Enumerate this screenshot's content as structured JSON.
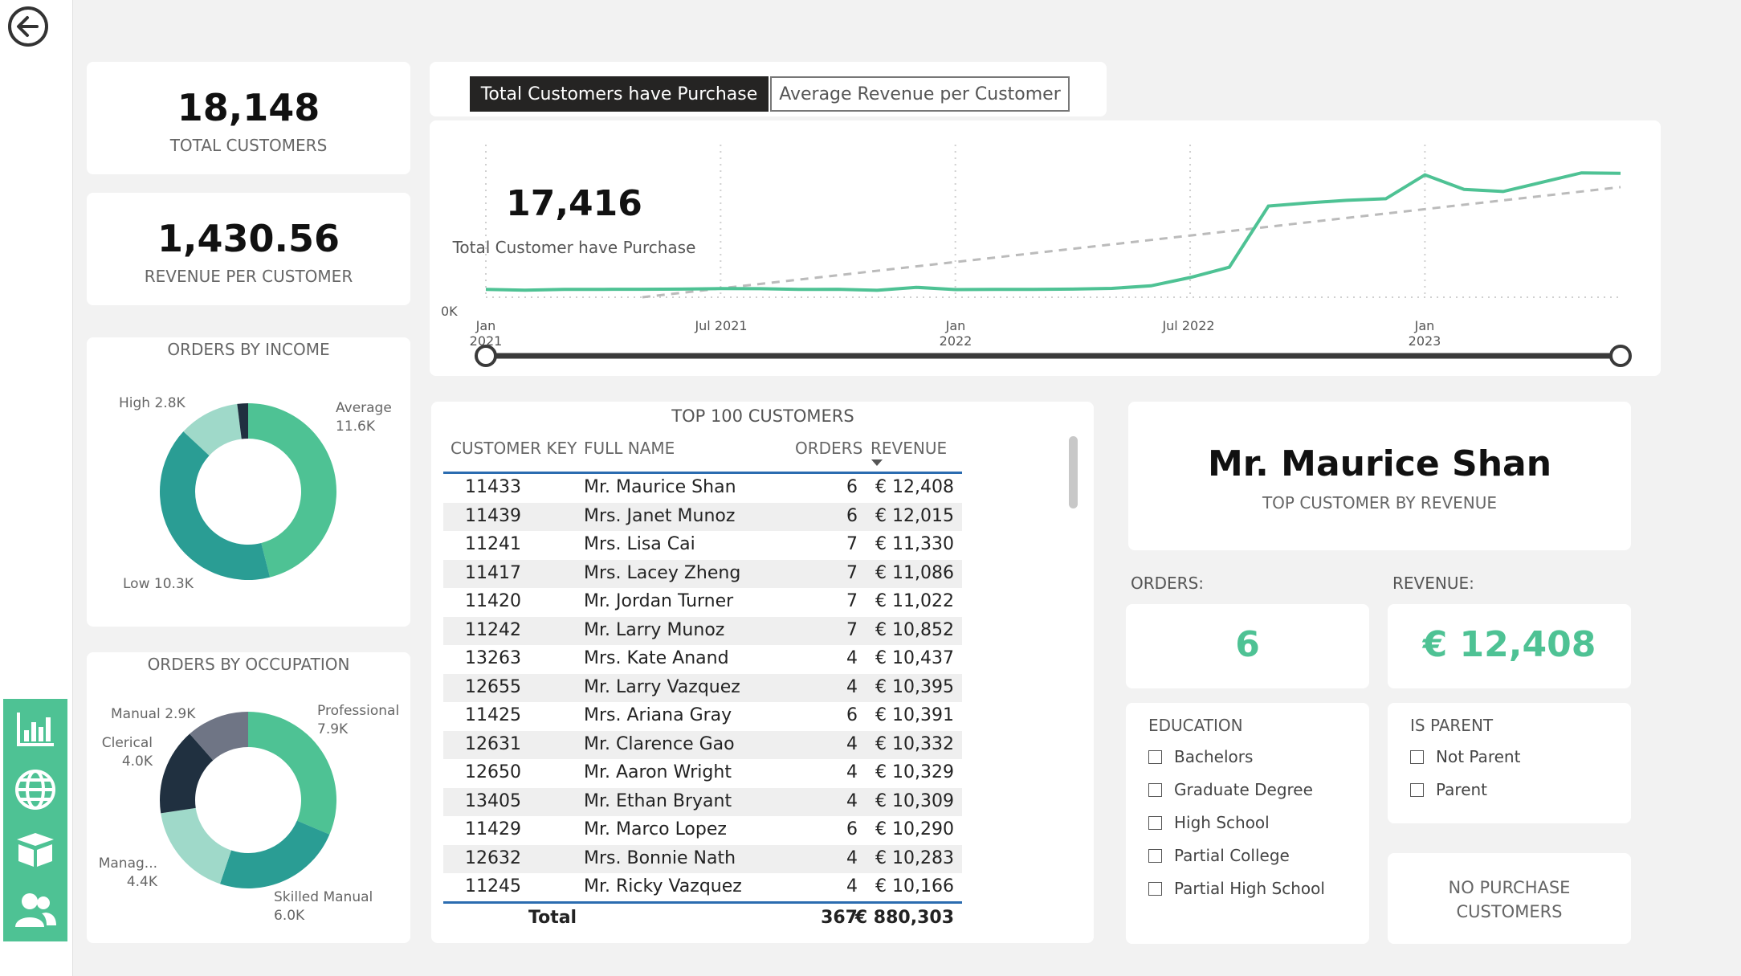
{
  "kpis": {
    "total_customers": {
      "value": "18,148",
      "label": "TOTAL CUSTOMERS"
    },
    "revenue_per_customer": {
      "value": "1,430.56",
      "label": "REVENUE PER CUSTOMER"
    }
  },
  "tabs": [
    {
      "label": "Total Customers have Purchase",
      "active": true
    },
    {
      "label": "Average Revenue per Customer",
      "active": false
    }
  ],
  "line_chart": {
    "kpi_value": "17,416",
    "kpi_label": "Total Customer have Purchase",
    "y_tick": "0K",
    "x_ticks": [
      "Jan 2021",
      "Jul 2021",
      "Jan 2022",
      "Jul 2022",
      "Jan 2023"
    ],
    "line_color": "#4ec294",
    "trend_color": "#bbbbbb"
  },
  "income_chart": {
    "title": "ORDERS BY INCOME",
    "labels": [
      {
        "name": "Average",
        "value": "11.6K"
      },
      {
        "name": "Low",
        "value": "10.3K"
      },
      {
        "name": "High",
        "value": "2.8K"
      }
    ]
  },
  "occupation_chart": {
    "title": "ORDERS BY OCCUPATION",
    "labels": [
      {
        "name": "Professional",
        "value": "7.9K"
      },
      {
        "name": "Skilled Manual",
        "value": "6.0K"
      },
      {
        "name": "Manag...",
        "value": "4.4K"
      },
      {
        "name": "Clerical",
        "value": "4.0K"
      },
      {
        "name": "Manual",
        "value": "2.9K"
      }
    ]
  },
  "chart_data": [
    {
      "type": "line",
      "title": "Total Customer have Purchase",
      "x": [
        "2021-01",
        "2021-02",
        "2021-03",
        "2021-04",
        "2021-05",
        "2021-06",
        "2021-07",
        "2021-08",
        "2021-09",
        "2021-10",
        "2021-11",
        "2021-12",
        "2022-01",
        "2022-02",
        "2022-03",
        "2022-04",
        "2022-05",
        "2022-06",
        "2022-07",
        "2022-08",
        "2022-09",
        "2022-10",
        "2022-11",
        "2022-12",
        "2023-01",
        "2023-02",
        "2023-03",
        "2023-04",
        "2023-05",
        "2023-06"
      ],
      "series": [
        {
          "values": [
            75,
            68,
            75,
            76,
            77,
            78,
            83,
            82,
            75,
            77,
            67,
            95,
            74,
            76,
            76,
            78,
            85,
            110,
            190,
            290,
            880,
            910,
            935,
            950,
            1180,
            1040,
            1020,
            1110,
            1200,
            1195
          ]
        }
      ],
      "y_min": 0,
      "y_max": 1240,
      "trendline": true,
      "xlabel": "",
      "ylabel": ""
    },
    {
      "type": "pie",
      "title": "ORDERS BY INCOME",
      "labels": [
        "Average",
        "Low",
        "High",
        "Other"
      ],
      "values": [
        11.6,
        10.3,
        2.8,
        0.5
      ],
      "colors": [
        "#4ec294",
        "#2a9d94",
        "#9fd9c9",
        "#203040"
      ]
    },
    {
      "type": "pie",
      "title": "ORDERS BY OCCUPATION",
      "labels": [
        "Professional",
        "Skilled Manual",
        "Manag...",
        "Clerical",
        "Manual"
      ],
      "values": [
        7.9,
        6.0,
        4.4,
        4.0,
        2.9
      ],
      "colors": [
        "#4ec294",
        "#2a9d94",
        "#9fd9c9",
        "#203040",
        "#6f7585"
      ]
    }
  ],
  "table": {
    "title": "TOP 100 CUSTOMERS",
    "headers": {
      "key": "CUSTOMER KEY",
      "name": "FULL NAME",
      "orders": "ORDERS",
      "revenue": "REVENUE"
    },
    "rows": [
      {
        "key": "11433",
        "name": "Mr. Maurice Shan",
        "orders": "6",
        "revenue": "€ 12,408"
      },
      {
        "key": "11439",
        "name": "Mrs. Janet Munoz",
        "orders": "6",
        "revenue": "€ 12,015"
      },
      {
        "key": "11241",
        "name": "Mrs. Lisa Cai",
        "orders": "7",
        "revenue": "€ 11,330"
      },
      {
        "key": "11417",
        "name": "Mrs. Lacey Zheng",
        "orders": "7",
        "revenue": "€ 11,086"
      },
      {
        "key": "11420",
        "name": "Mr. Jordan Turner",
        "orders": "7",
        "revenue": "€ 11,022"
      },
      {
        "key": "11242",
        "name": "Mr. Larry Munoz",
        "orders": "7",
        "revenue": "€ 10,852"
      },
      {
        "key": "13263",
        "name": "Mrs. Kate Anand",
        "orders": "4",
        "revenue": "€ 10,437"
      },
      {
        "key": "12655",
        "name": "Mr. Larry Vazquez",
        "orders": "4",
        "revenue": "€ 10,395"
      },
      {
        "key": "11425",
        "name": "Mrs. Ariana Gray",
        "orders": "6",
        "revenue": "€ 10,391"
      },
      {
        "key": "12631",
        "name": "Mr. Clarence Gao",
        "orders": "4",
        "revenue": "€ 10,332"
      },
      {
        "key": "12650",
        "name": "Mr. Aaron Wright",
        "orders": "4",
        "revenue": "€ 10,329"
      },
      {
        "key": "13405",
        "name": "Mr. Ethan Bryant",
        "orders": "4",
        "revenue": "€ 10,309"
      },
      {
        "key": "11429",
        "name": "Mr. Marco Lopez",
        "orders": "6",
        "revenue": "€ 10,290"
      },
      {
        "key": "12632",
        "name": "Mrs. Bonnie Nath",
        "orders": "4",
        "revenue": "€ 10,283"
      },
      {
        "key": "11245",
        "name": "Mr. Ricky Vazquez",
        "orders": "4",
        "revenue": "€ 10,166"
      }
    ],
    "total": {
      "label": "Total",
      "orders": "367",
      "revenue": "€ 880,303"
    }
  },
  "top_customer": {
    "name": "Mr. Maurice Shan",
    "label": "TOP CUSTOMER BY REVENUE"
  },
  "orders": {
    "label": "ORDERS:",
    "value": "6"
  },
  "revenue": {
    "label": "REVENUE:",
    "value": "€ 12,408"
  },
  "education": {
    "title": "EDUCATION",
    "options": [
      "Bachelors",
      "Graduate Degree",
      "High School",
      "Partial College",
      "Partial High School"
    ]
  },
  "is_parent": {
    "title": "IS PARENT",
    "options": [
      "Not Parent",
      "Parent"
    ]
  },
  "no_purchase": {
    "line1": "NO PURCHASE",
    "line2": "CUSTOMERS"
  },
  "nav_icons": [
    "bar-chart-icon",
    "globe-icon",
    "box-icon",
    "users-icon"
  ],
  "accent_color": "#4ec294"
}
